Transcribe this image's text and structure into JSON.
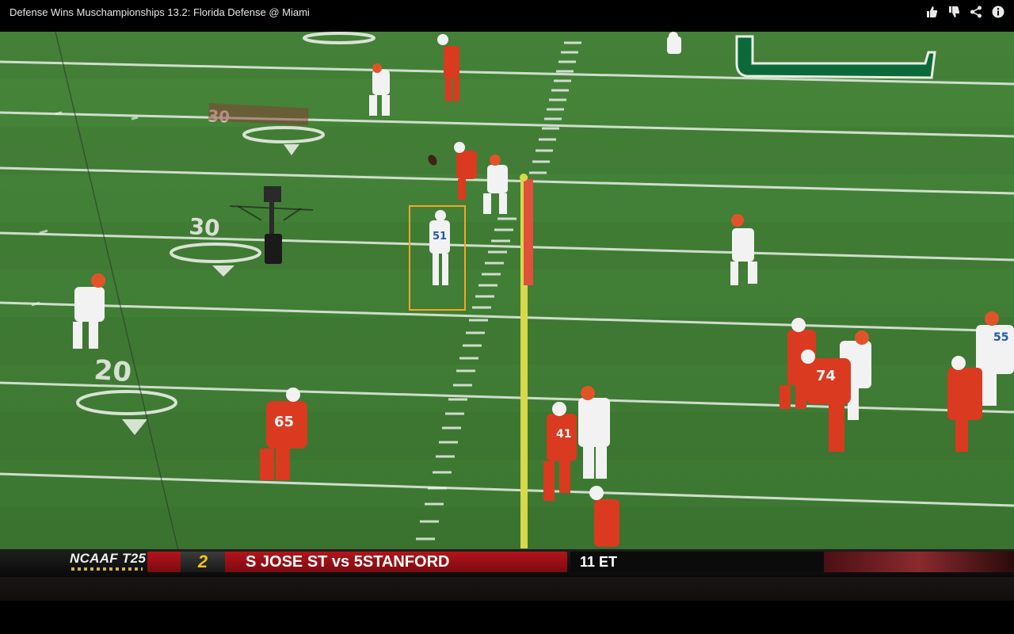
{
  "window": {
    "title": "Defense Wins Muschampionships 13.2: Florida Defense @ Miami"
  },
  "title_actions": [
    {
      "name": "thumbs-up-icon"
    },
    {
      "name": "thumbs-down-icon"
    },
    {
      "name": "share-icon"
    },
    {
      "name": "info-icon"
    }
  ],
  "colors": {
    "field": "#3f7a33",
    "highlight": "#f5a623",
    "florida": "#f2f2f2",
    "miami": "#d93a20"
  },
  "field_numbers": {
    "upper": "30",
    "middle": "30",
    "lower": "20"
  },
  "jerseys": {
    "j1": "51",
    "j2": "65",
    "j3": "74",
    "j4": "41",
    "j5": "55"
  },
  "ticker": {
    "label": "NCAAF T25",
    "rank": "2",
    "game": "S JOSE ST vs 5STANFORD",
    "time": "11 ET"
  }
}
